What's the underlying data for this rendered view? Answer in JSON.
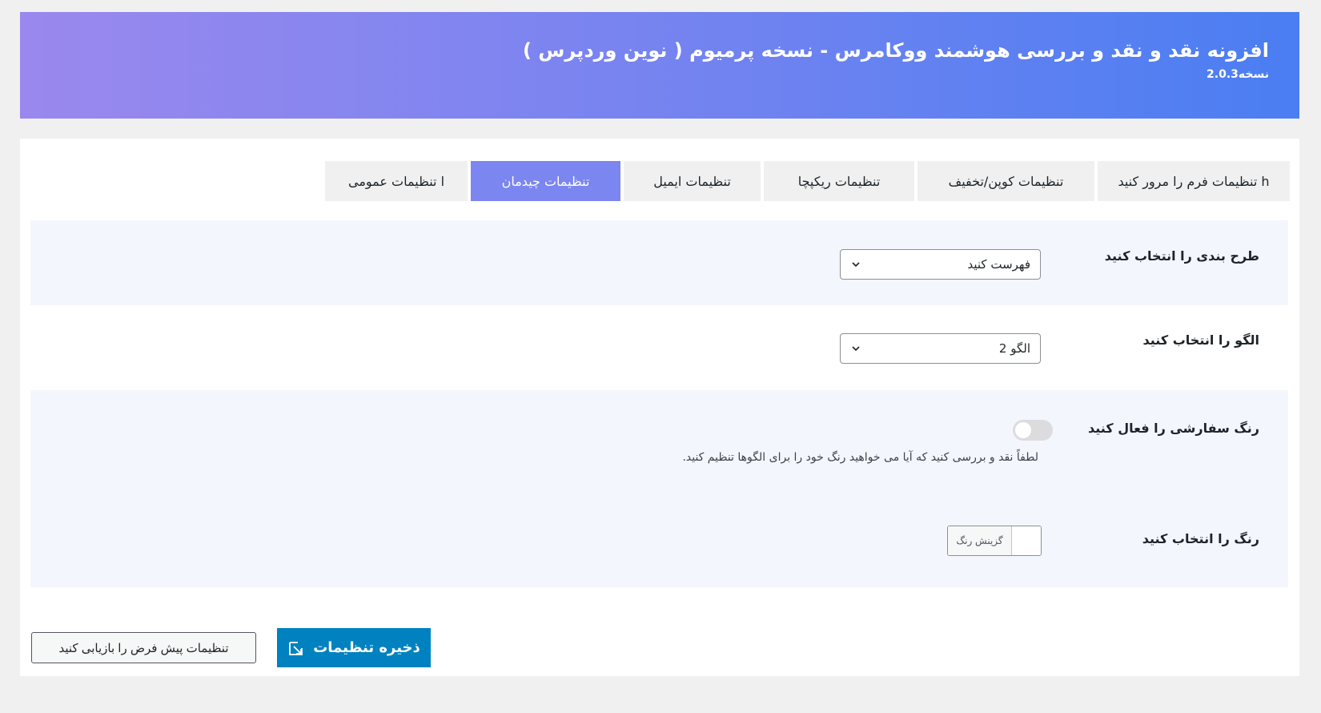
{
  "header": {
    "title": "افزونه نقد و نقد و بررسی هوشمند ووکامرس - نسخه پرمیوم ( نوین وردپرس )",
    "version": "نسخه2.0.3"
  },
  "tabs": [
    {
      "label": "l تنظیمات عمومی",
      "active": false
    },
    {
      "label": "تنظیمات چیدمان",
      "active": true
    },
    {
      "label": "تنظیمات ایمیل",
      "active": false
    },
    {
      "label": "تنظیمات ریکپچا",
      "active": false
    },
    {
      "label": "تنظیمات کوپن/تخفیف",
      "active": false
    },
    {
      "label": "h تنظیمات فرم را مرور کنید",
      "active": false
    }
  ],
  "settings": {
    "layout": {
      "label": "طرح بندی را انتخاب کنید",
      "value": "فهرست کنید"
    },
    "pattern": {
      "label": "الگو را انتخاب کنید",
      "value": "الگو 2"
    },
    "custom_color": {
      "label": "رنگ سفارشی را فعال کنید",
      "enabled": false,
      "description": "لطفاً نقد و بررسی کنید که آیا می خواهید رنگ خود را برای الگوها تنظیم کنید."
    },
    "color": {
      "label": "رنگ را انتخاب کنید",
      "button_label": "گزینش رنگ"
    }
  },
  "actions": {
    "save_label": "ذخیره تنظیمات",
    "reset_label": "تنظیمات پیش فرض را بازیابی کنید"
  },
  "colors": {
    "header_gradient_start": "#9a88ee",
    "header_gradient_end": "#4a7ef2",
    "active_tab": "#7b86f0",
    "save_button": "#0082c0",
    "shaded_row": "#f3f6fd"
  }
}
